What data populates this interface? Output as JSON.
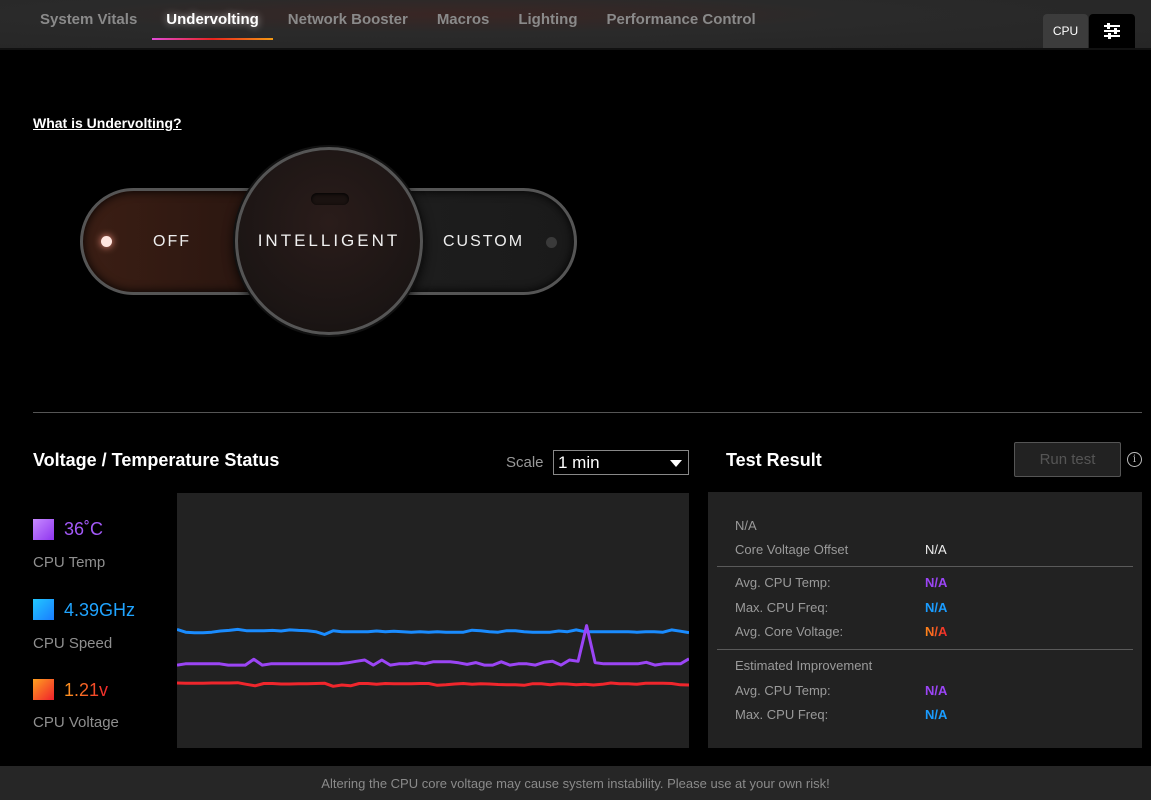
{
  "nav": {
    "tabs": [
      {
        "label": "System Vitals",
        "active": false
      },
      {
        "label": "Undervolting",
        "active": true
      },
      {
        "label": "Network Booster",
        "active": false
      },
      {
        "label": "Macros",
        "active": false
      },
      {
        "label": "Lighting",
        "active": false
      },
      {
        "label": "Performance Control",
        "active": false
      }
    ],
    "cpu_label": "CPU",
    "settings_icon": "sliders-icon"
  },
  "help_link": "What is Undervolting?",
  "mode_switch": {
    "options": [
      "OFF",
      "INTELLIGENT",
      "CUSTOM"
    ],
    "selected": "INTELLIGENT"
  },
  "status": {
    "title": "Voltage / Temperature Status",
    "scale_label": "Scale",
    "scale_value": "1 min",
    "legend": [
      {
        "value": "36˚C",
        "label": "CPU Temp",
        "color": "#9b45f5"
      },
      {
        "value": "4.39GHz",
        "label": "CPU Speed",
        "color": "#1a8cff"
      },
      {
        "value": "1.21v",
        "label": "CPU Voltage",
        "color": "#f0262c"
      }
    ]
  },
  "chart_data": {
    "type": "line",
    "title": "",
    "xlabel": "",
    "ylabel": "",
    "ylim": [
      0,
      100
    ],
    "grid": false,
    "series": [
      {
        "name": "CPU Speed",
        "color": "#1a8cff",
        "values": [
          46.5,
          45.4,
          45.2,
          45.2,
          45.4,
          45.9,
          46.1,
          46.5,
          46.0,
          46.0,
          46.0,
          46.1,
          45.9,
          46.3,
          46.1,
          46.0,
          45.6,
          44.5,
          46.0,
          45.6,
          45.6,
          45.6,
          45.6,
          45.9,
          45.6,
          45.8,
          45.6,
          45.4,
          45.6,
          45.4,
          45.6,
          45.4,
          45.4,
          45.4,
          46.2,
          46.0,
          45.6,
          45.4,
          46.0,
          46.0,
          45.6,
          45.4,
          45.4,
          45.4,
          45.9,
          45.6,
          46.3,
          45.6,
          45.6,
          45.6,
          45.6,
          45.6,
          45.6,
          45.4,
          45.6,
          45.6,
          45.4,
          46.3,
          45.8,
          45.2
        ]
      },
      {
        "name": "CPU Temp",
        "color": "#9b45f5",
        "values": [
          32.5,
          33.0,
          33.0,
          33.0,
          33.0,
          33.0,
          32.5,
          32.5,
          32.5,
          34.8,
          32.5,
          33.0,
          33.0,
          33.0,
          33.0,
          33.0,
          33.0,
          33.0,
          33.0,
          33.0,
          33.4,
          34.0,
          34.5,
          32.5,
          34.5,
          32.5,
          33.0,
          33.0,
          33.5,
          33.0,
          33.8,
          33.8,
          33.8,
          33.4,
          32.8,
          33.5,
          32.5,
          32.5,
          33.8,
          32.5,
          33.0,
          33.0,
          32.5,
          33.6,
          34.0,
          32.5,
          34.5,
          34.0,
          48.0,
          33.5,
          33.0,
          33.0,
          33.0,
          33.0,
          33.0,
          33.6,
          32.5,
          33.0,
          33.0,
          33.0,
          35.0
        ]
      },
      {
        "name": "CPU Voltage",
        "color": "#f0262c",
        "values": [
          25.5,
          25.4,
          25.4,
          25.4,
          25.5,
          25.5,
          25.5,
          25.6,
          25.0,
          24.4,
          25.3,
          25.3,
          25.1,
          25.1,
          25.2,
          25.2,
          25.3,
          25.4,
          24.2,
          24.7,
          24.4,
          25.3,
          25.3,
          25.0,
          25.3,
          25.2,
          25.2,
          25.2,
          25.3,
          25.3,
          24.6,
          24.8,
          25.1,
          25.3,
          25.0,
          25.2,
          25.1,
          24.9,
          24.8,
          24.8,
          24.6,
          25.2,
          25.2,
          24.8,
          25.2,
          25.1,
          24.8,
          25.0,
          24.7,
          25.0,
          25.5,
          25.2,
          25.2,
          25.0,
          25.4,
          25.4,
          25.4,
          25.3,
          24.8,
          24.7
        ]
      }
    ]
  },
  "test_result": {
    "title": "Test Result",
    "run_button": "Run test",
    "info_icon": "info-icon",
    "status": "N/A",
    "offset_label": "Core Voltage Offset",
    "offset_value": "N/A",
    "rows": [
      {
        "label": "Avg. CPU Temp:",
        "value": "N/A",
        "color": "#9b45f5"
      },
      {
        "label": "Max. CPU Freq:",
        "value": "N/A",
        "color": "#1a8cff"
      },
      {
        "label": "Avg. Core Voltage:",
        "value": "N/A",
        "color": "#f0262c"
      }
    ],
    "improvement_label": "Estimated Improvement",
    "improvement_rows": [
      {
        "label": "Avg. CPU Temp:",
        "value": "N/A",
        "color": "#9b45f5"
      },
      {
        "label": "Max. CPU Freq:",
        "value": "N/A",
        "color": "#1a8cff"
      }
    ]
  },
  "footer": "Altering the CPU core voltage may cause system instability. Please use at your own risk!"
}
